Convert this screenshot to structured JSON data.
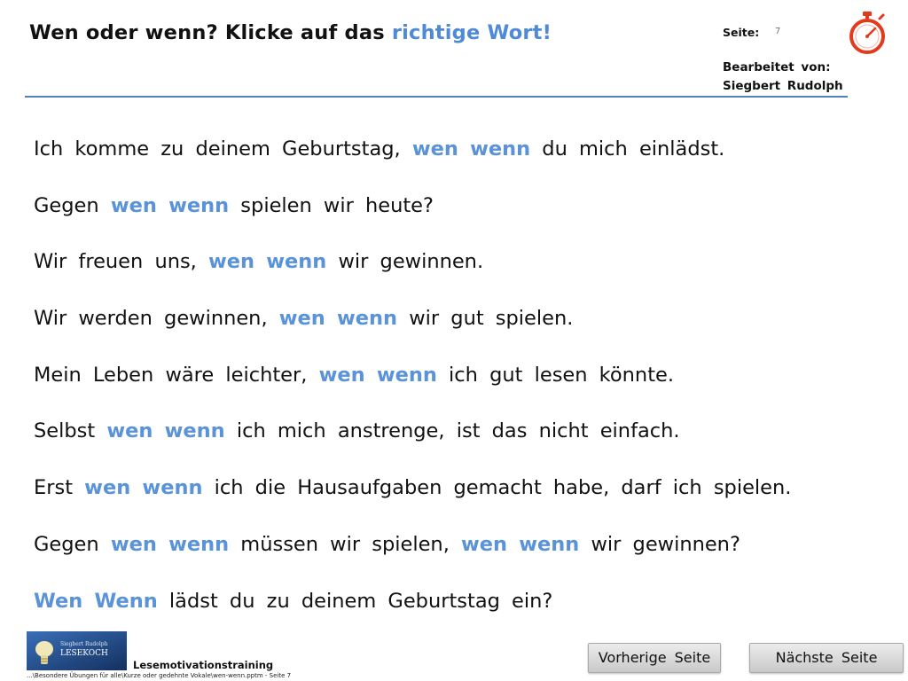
{
  "header": {
    "title_prefix": "Wen oder wenn? Klicke auf das ",
    "title_accent": "richtige Wort!",
    "page_label": "Seite:",
    "page_number": "7",
    "edited_by_label": "Bearbeitet von:",
    "author": "Siegbert Rudolph",
    "timer_icon": "stopwatch-icon",
    "accent_color": "#4f8ad6"
  },
  "sentences": [
    {
      "before": "Ich komme zu deinem Geburtstag, ",
      "opt1": "wen",
      "opt2": "wenn",
      "after": " du mich einlädst."
    },
    {
      "before": "Gegen ",
      "opt1": "wen",
      "opt2": "wenn",
      "after": " spielen wir heute?"
    },
    {
      "before": "Wir freuen uns, ",
      "opt1": "wen",
      "opt2": "wenn",
      "after": " wir gewinnen."
    },
    {
      "before": "Wir werden gewinnen, ",
      "opt1": "wen",
      "opt2": "wenn",
      "after": " wir gut spielen."
    },
    {
      "before": "Mein Leben wäre leichter, ",
      "opt1": "wen",
      "opt2": "wenn",
      "after": " ich gut lesen könnte."
    },
    {
      "before": "Selbst ",
      "opt1": "wen",
      "opt2": "wenn",
      "after": " ich mich anstrenge, ist das nicht einfach."
    },
    {
      "before": "Erst ",
      "opt1": "wen",
      "opt2": "wenn",
      "after": " ich die Hausaufgaben gemacht habe, darf ich spielen."
    },
    {
      "before": "Gegen ",
      "opt1": "wen",
      "opt2": "wenn",
      "mid": " müssen wir spielen, ",
      "opt3": "wen",
      "opt4": "wenn",
      "after": " wir gewinnen?"
    },
    {
      "before": "",
      "opt1": "Wen",
      "opt2": "Wenn",
      "after": " lädst du zu deinem Geburtstag ein?"
    }
  ],
  "footer": {
    "logo_line1": "Siegbert Rudolph",
    "logo_line2": "LESEKOCH",
    "course_label": "Lesemotivationstraining",
    "file_path": "...\\Besondere Übungen für alle\\Kurze oder gedehnte Vokale\\wen-wenn.pptm - Seite 7",
    "prev_button": "Vorherige Seite",
    "next_button": "Nächste Seite"
  }
}
